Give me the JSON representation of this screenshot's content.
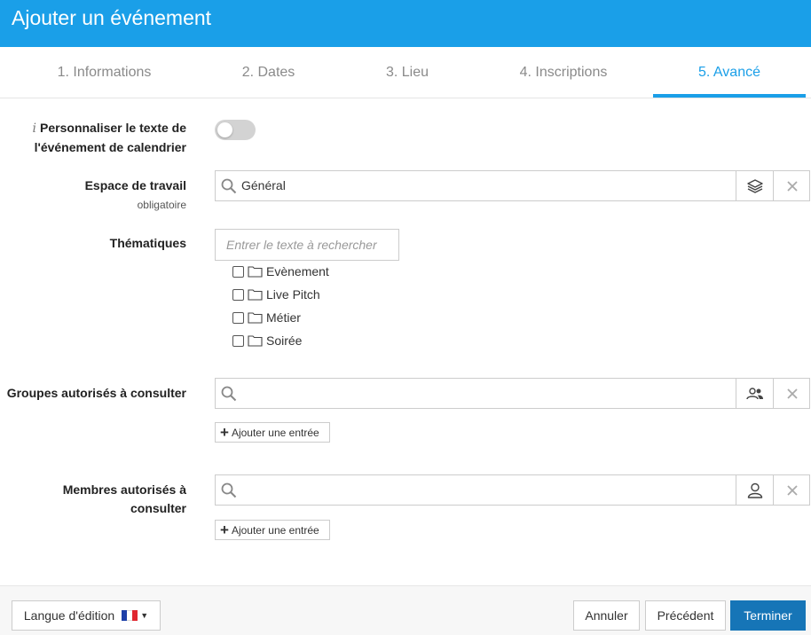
{
  "header": {
    "title": "Ajouter un événement"
  },
  "tabs": [
    {
      "label": "1. Informations",
      "active": false
    },
    {
      "label": "2. Dates",
      "active": false
    },
    {
      "label": "3. Lieu",
      "active": false
    },
    {
      "label": "4. Inscriptions",
      "active": false
    },
    {
      "label": "5. Avancé",
      "active": true
    }
  ],
  "form": {
    "custom_text": {
      "info": "i",
      "label_line1": "Personnaliser le texte de",
      "label_line2": "l'événement de calendrier",
      "enabled": false
    },
    "workspace": {
      "label": "Espace de travail",
      "sublabel": "obligatoire",
      "value": "Général"
    },
    "themes": {
      "label": "Thématiques",
      "search_placeholder": "Entrer le texte à rechercher",
      "items": [
        "Evènement",
        "Live Pitch",
        "Métier",
        "Soirée"
      ]
    },
    "groups": {
      "label": "Groupes autorisés à consulter",
      "value": "",
      "add_label": "Ajouter une entrée"
    },
    "members": {
      "label_line1": "Membres autorisés à",
      "label_line2": "consulter",
      "value": "",
      "add_label": "Ajouter une entrée"
    }
  },
  "footer": {
    "language_label": "Langue d'édition",
    "language_flag": "fr-flag-icon",
    "cancel_label": "Annuler",
    "previous_label": "Précédent",
    "finish_label": "Terminer"
  },
  "colors": {
    "accent": "#1a9fe8",
    "primary_button": "#1675b7"
  }
}
